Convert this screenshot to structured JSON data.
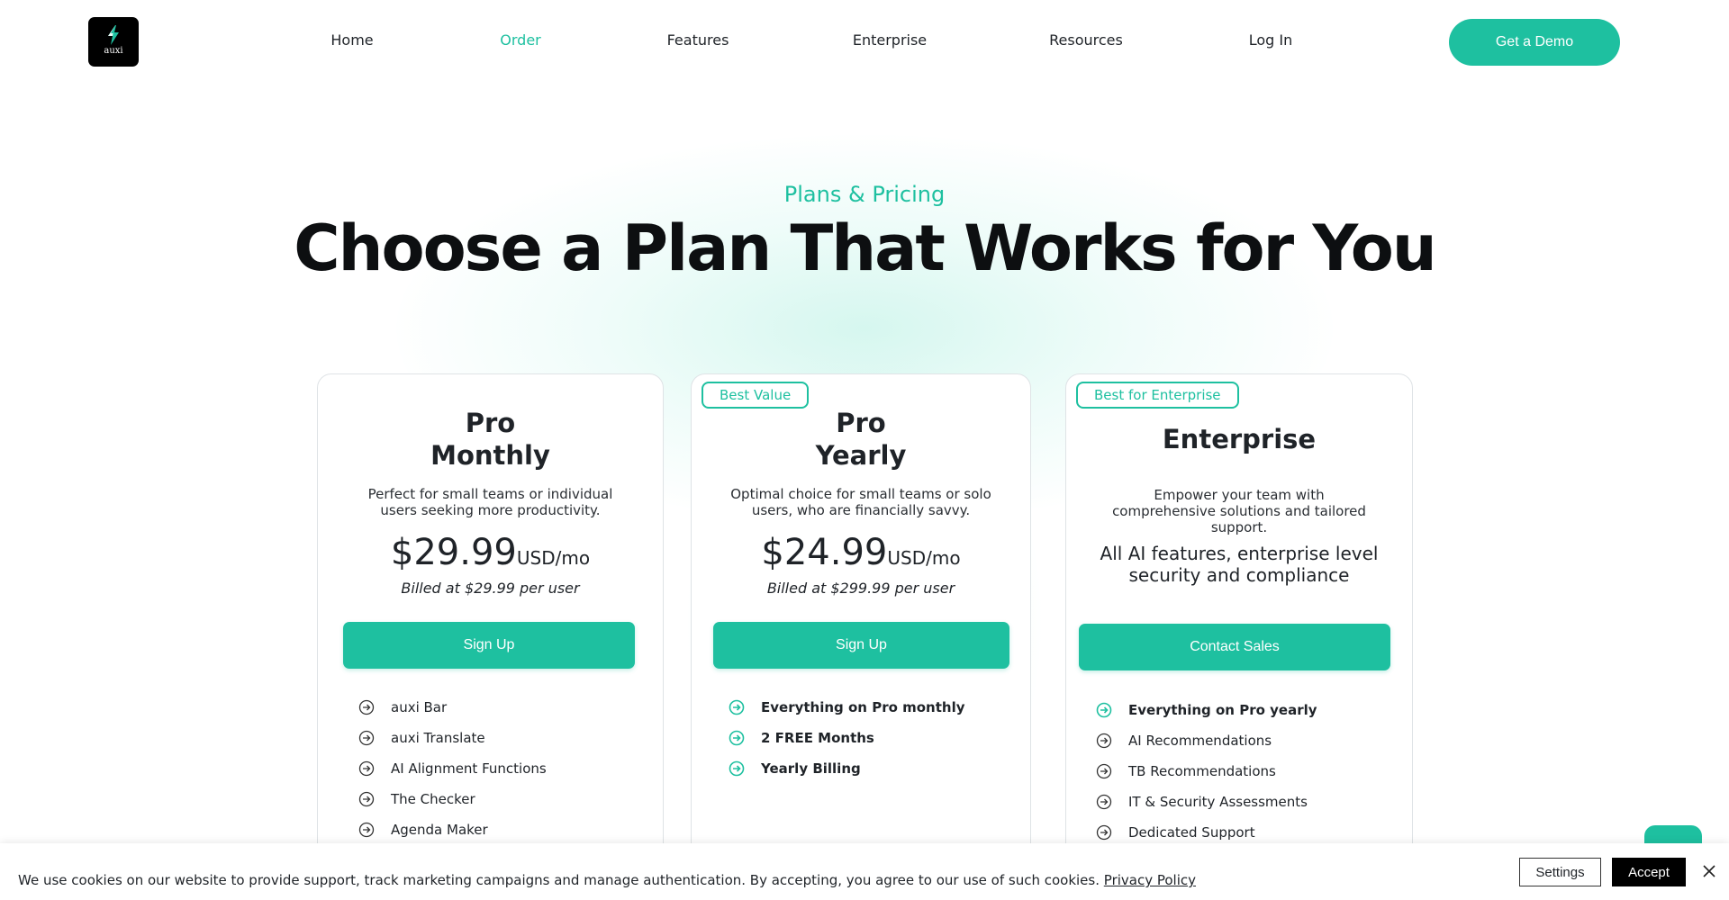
{
  "header": {
    "logo_text": "auxi",
    "nav": [
      {
        "label": "Home"
      },
      {
        "label": "Order",
        "active": true
      },
      {
        "label": "Features"
      },
      {
        "label": "Enterprise"
      },
      {
        "label": "Resources"
      },
      {
        "label": "Log In"
      }
    ],
    "demo_label": "Get a Demo"
  },
  "hero": {
    "eyebrow": "Plans & Pricing",
    "title": "Choose a Plan That Works for You"
  },
  "plans": [
    {
      "badge": "",
      "name_line1": "Pro",
      "name_line2": "Monthly",
      "description": "Perfect for small teams or individual users seeking more productivity.",
      "price": "$29.99",
      "price_unit": "USD/mo",
      "billed": "Billed at $29.99 per user",
      "button": "Sign Up",
      "features": [
        "auxi Bar",
        "auxi Translate",
        "AI Alignment Functions",
        "The Checker",
        "Agenda Maker"
      ]
    },
    {
      "badge": "Best Value",
      "name_line1": "Pro",
      "name_line2": "Yearly",
      "description": "Optimal choice for small teams or solo users, who are financially savvy.",
      "price": "$24.99",
      "price_unit": "USD/mo",
      "billed": "Billed at $299.99 per user",
      "button": "Sign Up",
      "features": [
        "Everything on Pro monthly",
        "2 FREE Months",
        "Yearly Billing"
      ]
    },
    {
      "badge": "Best for Enterprise",
      "name": "Enterprise",
      "description": "Empower your team with comprehensive solutions and tailored support.",
      "pitch": "All AI features, enterprise level security and compliance",
      "button": "Contact Sales",
      "features": [
        "Everything on Pro yearly",
        "AI Recommendations",
        "TB Recommendations",
        "IT & Security Assessments",
        "Dedicated Support"
      ]
    }
  ],
  "cookie": {
    "text": "We use cookies on our website to provide support, track marketing campaigns and manage authentication. By accepting, you agree to our use of such cookies.",
    "link": "Privacy Policy",
    "settings": "Settings",
    "accept": "Accept"
  },
  "colors": {
    "accent": "#1ec0a0",
    "text": "#1f2328"
  },
  "icons": {
    "logo": "lightning-bolt-icon",
    "feature_bullet": "circle-arrow-right-icon",
    "close": "close-icon"
  }
}
